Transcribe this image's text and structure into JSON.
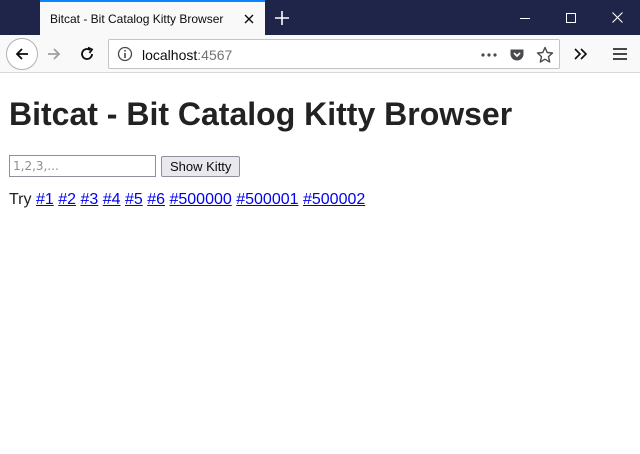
{
  "window": {
    "tab_title": "Bitcat - Bit Catalog Kitty Browser"
  },
  "navbar": {
    "url_host": "localhost",
    "url_port": ":4567"
  },
  "page": {
    "heading": "Bitcat - Bit Catalog Kitty Browser",
    "input_placeholder": "1,2,3,...",
    "input_value": "",
    "button_label": "Show Kitty",
    "try_label": "Try",
    "links": [
      "#1",
      "#2",
      "#3",
      "#4",
      "#5",
      "#6",
      "#500000",
      "#500001",
      "#500002"
    ]
  },
  "icons": {
    "tab_close": "close-icon",
    "new_tab": "plus-icon",
    "minimize": "minimize-icon",
    "maximize": "maximize-icon",
    "close_window": "close-icon",
    "back": "back-arrow-icon",
    "forward": "forward-arrow-icon",
    "reload": "reload-icon",
    "info": "info-icon",
    "more": "ellipsis-icon",
    "pocket": "pocket-icon",
    "bookmark": "star-icon",
    "overflow": "double-chevron-icon",
    "menu": "hamburger-menu-icon"
  },
  "colors": {
    "titlebar": "#1f2449",
    "tab_accent": "#0a84ff",
    "link": "#0000ee"
  }
}
